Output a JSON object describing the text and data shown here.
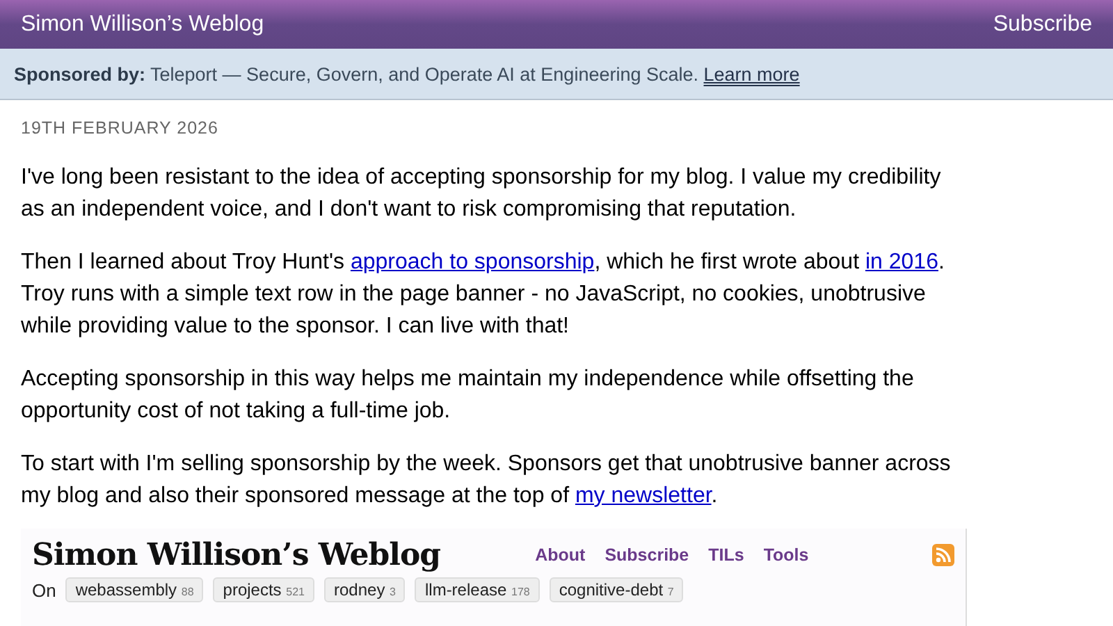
{
  "header": {
    "title": "Simon Willison’s Weblog",
    "subscribe": "Subscribe"
  },
  "sponsor": {
    "label": "Sponsored by:",
    "text": "Teleport — Secure, Govern, and Operate AI at Engineering Scale.",
    "link": "Learn more"
  },
  "date": "19TH FEBRUARY 2026",
  "paragraphs": [
    [
      {
        "kind": "text",
        "text": "I've long been resistant to the idea of accepting sponsorship for my blog. I value my credibility as an independent voice, and I don't want to risk compromising that reputation."
      }
    ],
    [
      {
        "kind": "text",
        "text": "Then I learned about Troy Hunt's "
      },
      {
        "kind": "link",
        "text": "approach to sponsorship"
      },
      {
        "kind": "text",
        "text": ", which he first wrote about "
      },
      {
        "kind": "link",
        "text": "in 2016"
      },
      {
        "kind": "text",
        "text": ". Troy runs with a simple text row in the page banner - no JavaScript, no cookies, unobtrusive while providing value to the sponsor. I can live with that!"
      }
    ],
    [
      {
        "kind": "text",
        "text": "Accepting sponsorship in this way helps me maintain my independence while offsetting the opportunity cost of not taking a full-time job."
      }
    ],
    [
      {
        "kind": "text",
        "text": "To start with I'm selling sponsorship by the week. Sponsors get that unobtrusive banner across my blog and also their sponsored message at the top of "
      },
      {
        "kind": "link",
        "text": "my newsletter"
      },
      {
        "kind": "text",
        "text": "."
      }
    ]
  ],
  "screenshot": {
    "title": "Simon Willison’s Weblog",
    "nav": [
      "About",
      "Subscribe",
      "TILs",
      "Tools"
    ],
    "on_label": "On",
    "tags": [
      {
        "name": "webassembly",
        "count": "88"
      },
      {
        "name": "projects",
        "count": "521"
      },
      {
        "name": "rodney",
        "count": "3"
      },
      {
        "name": "llm-release",
        "count": "178"
      },
      {
        "name": "cognitive-debt",
        "count": "7"
      }
    ]
  }
}
